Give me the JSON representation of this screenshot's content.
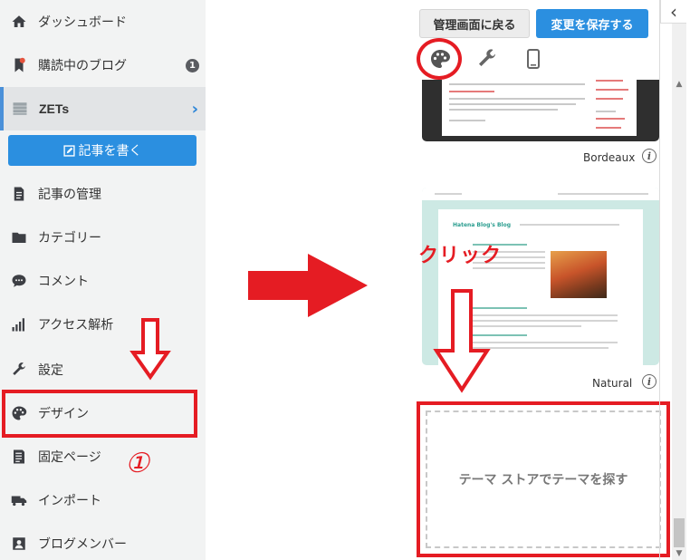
{
  "sidebar": {
    "items": [
      {
        "label": "ダッシュボード",
        "icon": "home-icon"
      },
      {
        "label": "購読中のブログ",
        "icon": "bookmark-icon",
        "badge": "1"
      },
      {
        "label": "ZETs",
        "icon": "blog-thumbnail-icon",
        "active": true
      },
      {
        "label": "記事の管理",
        "icon": "document-icon"
      },
      {
        "label": "カテゴリー",
        "icon": "folder-icon"
      },
      {
        "label": "コメント",
        "icon": "comment-icon"
      },
      {
        "label": "アクセス解析",
        "icon": "bar-chart-icon"
      },
      {
        "label": "設定",
        "icon": "wrench-icon"
      },
      {
        "label": "デザイン",
        "icon": "palette-icon"
      },
      {
        "label": "固定ページ",
        "icon": "page-icon"
      },
      {
        "label": "インポート",
        "icon": "truck-icon"
      },
      {
        "label": "ブログメンバー",
        "icon": "member-icon"
      }
    ],
    "write_button": "記事を書く"
  },
  "annotations": {
    "step_number": "①",
    "click_text": "クリック",
    "accent_color": "#e51c23"
  },
  "header": {
    "back_button": "管理画面に戻る",
    "save_button": "変更を保存する",
    "collapse_glyph": "‹"
  },
  "tabs": [
    {
      "icon": "palette-icon"
    },
    {
      "icon": "wrench-icon"
    },
    {
      "icon": "smartphone-icon"
    }
  ],
  "themes": [
    {
      "name": "Bordeaux",
      "info": "i"
    },
    {
      "name": "Natural",
      "info": "i",
      "thumb_title": "Hatena Blog's Blog"
    }
  ],
  "store": {
    "label": "テーマ ストアでテーマを探す"
  },
  "colors": {
    "primary": "#2b8fe0",
    "sidebar_bg": "#f2f3f3",
    "annotation": "#e51c23"
  }
}
